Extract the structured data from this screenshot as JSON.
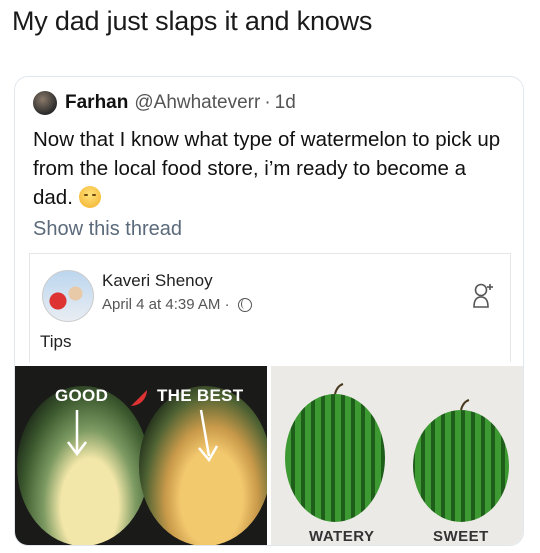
{
  "meme": {
    "caption": "My dad just slaps it and knows"
  },
  "tweet": {
    "author_name": "Farhan",
    "author_handle": "@Ahwhateverr",
    "separator": "·",
    "time": "1d",
    "text": "Now that I know what type of watermelon to pick up from the local food store, i’m ready to become a dad.",
    "emoji": "relieved-face-emoji",
    "show_thread": "Show this thread"
  },
  "facebook_post": {
    "author": "Kaveri Shenoy",
    "date": "April 4 at 4:39 AM ·",
    "text": "Tips",
    "icons": [
      "globe-icon",
      "add-friend-icon"
    ]
  },
  "images": {
    "left": {
      "label_1": "GOOD",
      "label_2": "THE BEST"
    },
    "right": {
      "label_1": "WATERY",
      "label_2": "SWEET"
    }
  },
  "colors": {
    "link_gray": "#5a6a7a",
    "card_border": "#e1e8ed",
    "melon_green": "#2f8a2c",
    "melon_dark": "#1e5e1a"
  }
}
